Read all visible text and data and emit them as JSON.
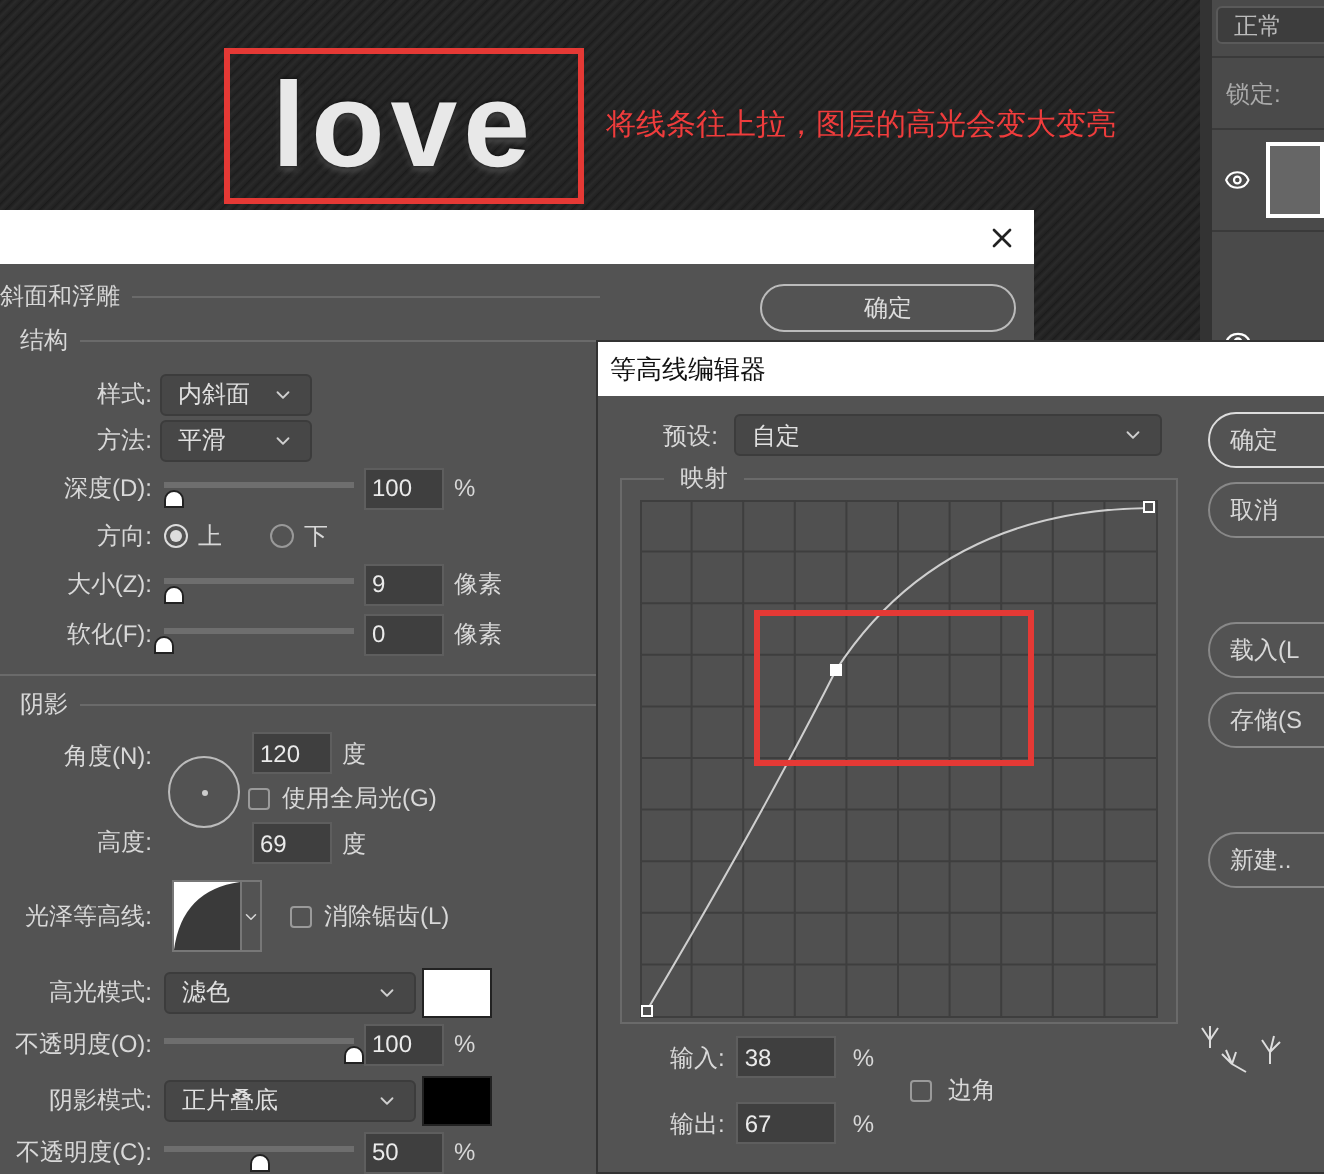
{
  "canvas": {
    "artwork_text": "love",
    "annotation": "将线条往上拉，图层的高光会变大变亮"
  },
  "layers_panel": {
    "blend_mode": "正常",
    "lock_label": "锁定:"
  },
  "layer_style": {
    "section": "斜面和浮雕",
    "structure": {
      "title": "结构",
      "style": {
        "label": "样式:",
        "value": "内斜面"
      },
      "technique": {
        "label": "方法:",
        "value": "平滑"
      },
      "depth": {
        "label": "深度(D):",
        "level": 0.05,
        "value": "100",
        "unit": "%"
      },
      "direction": {
        "label": "方向:",
        "options": [
          {
            "label": "上",
            "selected": true
          },
          {
            "label": "下",
            "selected": false
          }
        ]
      },
      "size": {
        "label": "大小(Z):",
        "level": 0.05,
        "value": "9",
        "unit": "像素"
      },
      "soften": {
        "label": "软化(F):",
        "level": 0,
        "value": "0",
        "unit": "像素"
      }
    },
    "shading": {
      "title": "阴影",
      "angle": {
        "label": "角度(N):",
        "value": "120",
        "unit": "度"
      },
      "global_light": {
        "label": "使用全局光(G)",
        "checked": false
      },
      "altitude": {
        "label": "高度:",
        "value": "69",
        "unit": "度"
      },
      "gloss_contour": {
        "label": "光泽等高线:"
      },
      "anti_aliased": {
        "label": "消除锯齿(L)",
        "checked": false
      },
      "highlight_mode": {
        "label": "高光模式:",
        "value": "滤色",
        "color": "#ffffff"
      },
      "highlight_opacity": {
        "label": "不透明度(O):",
        "level": 1,
        "value": "100",
        "unit": "%"
      },
      "shadow_mode": {
        "label": "阴影模式:",
        "value": "正片叠底",
        "color": "#000000"
      },
      "shadow_opacity": {
        "label": "不透明度(C):",
        "level": 0.5,
        "value": "50",
        "unit": "%"
      }
    },
    "ok_button": "确定"
  },
  "contour_editor": {
    "title": "等高线编辑器",
    "preset": {
      "label": "预设:",
      "value": "自定"
    },
    "mapping_title": "映射",
    "input": {
      "label": "输入:",
      "value": "38",
      "unit": "%"
    },
    "output": {
      "label": "输出:",
      "value": "67",
      "unit": "%"
    },
    "corner": {
      "label": "边角",
      "checked": false
    },
    "buttons": [
      "确定",
      "取消",
      "载入(L",
      "存储(S",
      "新建.."
    ]
  }
}
